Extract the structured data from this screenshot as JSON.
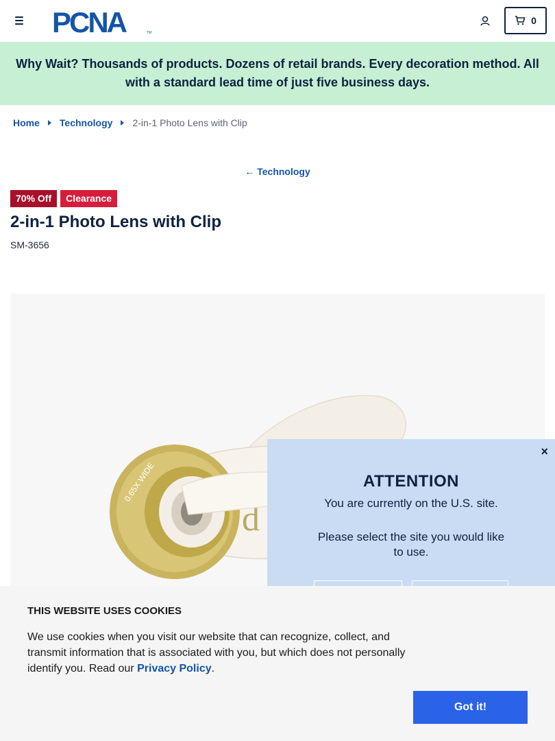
{
  "header": {
    "logo_text": "PCNA",
    "logo_tm": "TM",
    "cart_count": "0",
    "brand_color": "#1455a8"
  },
  "promo": {
    "text": "Why Wait? Thousands of products. Dozens of retail brands. Every decoration method. All with a standard lead time of just five business days."
  },
  "breadcrumb": {
    "items": [
      {
        "label": "Home"
      },
      {
        "label": "Technology"
      }
    ],
    "current": "2-in-1 Photo Lens with Clip"
  },
  "back_link": {
    "label": "Technology"
  },
  "product": {
    "badges": [
      {
        "label": "70% Off",
        "color": "#a8102a"
      },
      {
        "label": "Clearance",
        "color": "#d61d3b"
      }
    ],
    "title": "2-in-1 Photo Lens with Clip",
    "sku": "SM-3656",
    "image": {
      "lens_text": "0.65X WIDE",
      "clip_logo": "d"
    }
  },
  "attention_popup": {
    "close_icon": "×",
    "title": "ATTENTION",
    "message": "You are currently on the U.S. site.",
    "prompt": "Please select the site you would like to use."
  },
  "cookie_banner": {
    "title": "THIS WEBSITE USES COOKIES",
    "text_before_link": "We use cookies when you visit our website that can recognize, collect, and transmit information that is associated with you, but which does not personally identify you. Read our ",
    "link_text": "Privacy Policy",
    "text_after_link": ".",
    "accept_label": "Got it!"
  }
}
